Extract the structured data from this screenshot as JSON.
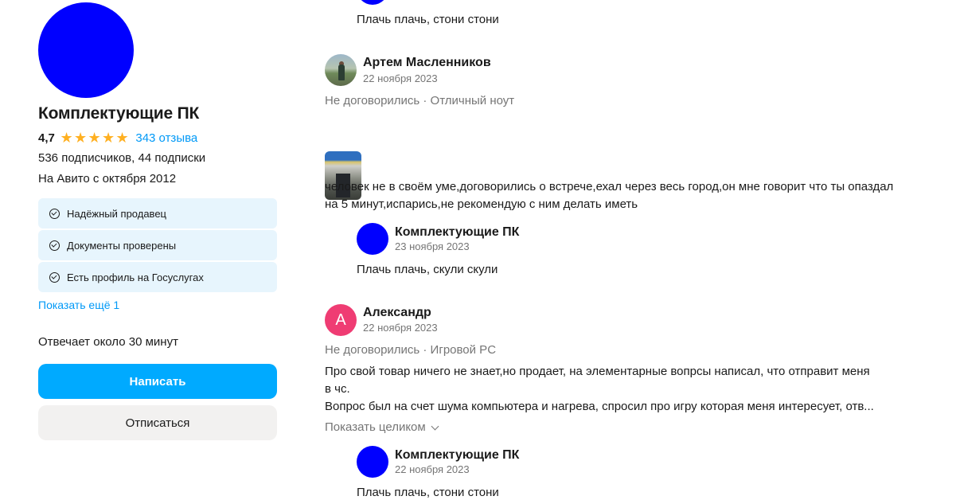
{
  "seller": {
    "name": "Комплектующие ПК",
    "rating": "4,7",
    "stars": 5,
    "reviews_link": "343 отзыва",
    "subscriptions": "536 подписчиков, 44 подписки",
    "since": "На Авито с октября 2012",
    "badges": [
      {
        "label": "Надёжный продавец",
        "icon": "check-circle-icon"
      },
      {
        "label": "Документы проверены",
        "icon": "check-circle-icon"
      },
      {
        "label": "Есть профиль на Госуслугах",
        "icon": "check-circle-icon"
      }
    ],
    "show_more": "Показать ещё 1",
    "response_time": "Отвечает около 30 минут",
    "write_button": "Написать",
    "unsubscribe_button": "Отписаться"
  },
  "reviews": {
    "top_reply": {
      "text": "Плачь плачь, стони стони"
    },
    "items": [
      {
        "author": "Артем Масленников",
        "date": "22 ноября 2023",
        "meta": "Не договорились · Отличный ноут",
        "text": "человек не в своём уме,договорились о встрече,ехал через весь город,он мне говорит что ты опаздал на 5 минут,испарись,не рекомендую с ним делать иметь",
        "reply": {
          "author": "Комплектующие ПК",
          "date": "23 ноября 2023",
          "text": "Плачь плачь, скули скули"
        }
      },
      {
        "author": "Александр",
        "avatar_letter": "А",
        "date": "22 ноября 2023",
        "meta": "Не договорились · Игровой PC",
        "text_lines": [
          "Про свой товар ничего не знает,но продает, на элементарные вопрсы написал, что отправит меня",
          "в чс.",
          "Вопрос был на счет шума компьютера и нагрева, спросил про игру которая меня интересует, отв..."
        ],
        "show_full": "Показать целиком",
        "reply": {
          "author": "Комплектующие ПК",
          "date": "22 ноября 2023",
          "text": "Плачь плачь, стони стони"
        }
      }
    ]
  },
  "colors": {
    "accent": "#00aaff",
    "link": "#0099f7",
    "star": "#ffb021",
    "badge_bg": "#e7f5fd",
    "avatar_letter_bg": "#ef3c73"
  }
}
